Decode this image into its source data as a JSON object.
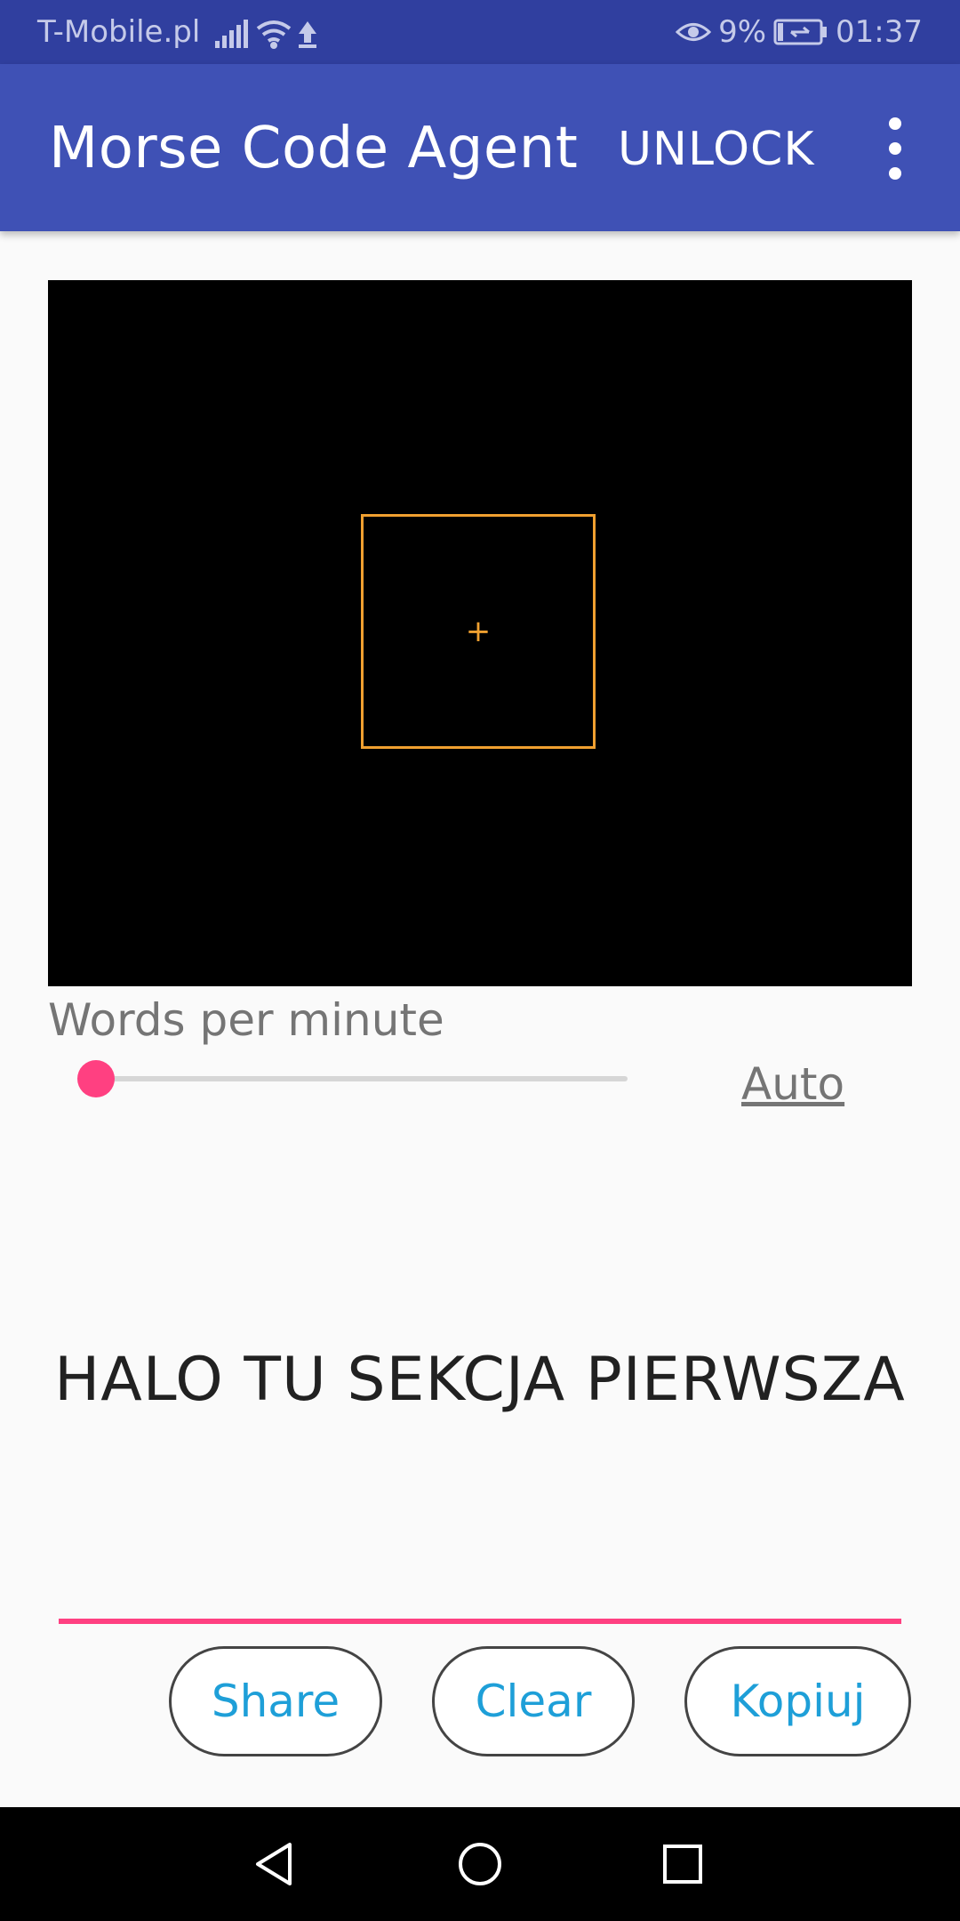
{
  "status_bar": {
    "carrier": "T-Mobile.pl",
    "battery": "9%",
    "time": "01:37"
  },
  "app_bar": {
    "title": "Morse Code Agent",
    "unlock_label": "UNLOCK"
  },
  "wpm": {
    "label": "Words per minute",
    "slider_fraction": 0.0,
    "auto_label": "Auto"
  },
  "decoded_text": "HALO TU SEKCJA PIERWSZA",
  "actions": {
    "share_label": "Share",
    "clear_label": "Clear",
    "copy_label": "Kopiuj"
  },
  "colors": {
    "status_bar": "#303F9F",
    "app_bar": "#3F51B5",
    "accent": "#FF4081",
    "button_text": "#1E9FD8",
    "focus_box": "#F0A030"
  },
  "icons": [
    "signal-icon",
    "wifi-icon",
    "upload-icon",
    "eye-icon",
    "battery-icon",
    "overflow-menu-icon",
    "back-icon",
    "home-icon",
    "recent-apps-icon"
  ]
}
